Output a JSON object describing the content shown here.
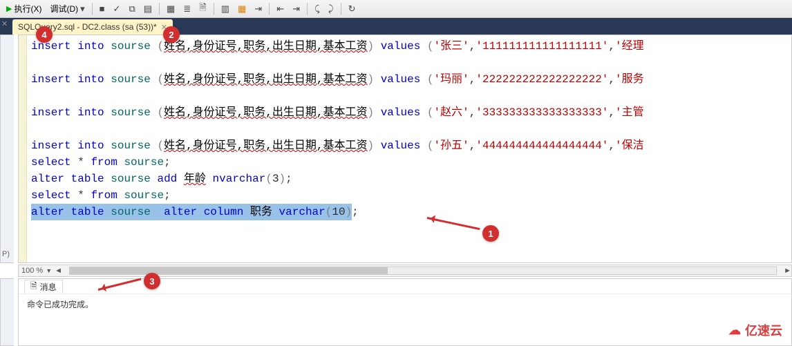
{
  "toolbar": {
    "execute_label": "执行(X)",
    "debug_label": "调试(D)"
  },
  "tab": {
    "title": "SQLQuery2.sql - DC2.class (sa (53))*"
  },
  "code": {
    "l1": {
      "kw1": "insert",
      "kw2": "into",
      "ident": "sourse",
      "paren_open": "(",
      "cols": "姓名,身份证号,职务,出生日期,基本工资",
      "paren_close": ")",
      "kw3": "values",
      "v_open": "(",
      "s1": "'张三'",
      "c": ",",
      "s2": "'111111111111111111'",
      "s3": "'经理"
    },
    "l3": {
      "kw1": "insert",
      "kw2": "into",
      "ident": "sourse",
      "paren_open": "(",
      "cols": "姓名,身份证号,职务,出生日期,基本工资",
      "paren_close": ")",
      "kw3": "values",
      "v_open": "(",
      "s1": "'玛丽'",
      "c": ",",
      "s2": "'222222222222222222'",
      "s3": "'服务"
    },
    "l5": {
      "kw1": "insert",
      "kw2": "into",
      "ident": "sourse",
      "paren_open": "(",
      "cols": "姓名,身份证号,职务,出生日期,基本工资",
      "paren_close": ")",
      "kw3": "values",
      "v_open": "(",
      "s1": "'赵六'",
      "c": ",",
      "s2": "'333333333333333333'",
      "s3": "'主管"
    },
    "l7": {
      "kw1": "insert",
      "kw2": "into",
      "ident": "sourse",
      "paren_open": "(",
      "cols": "姓名,身份证号,职务,出生日期,基本工资",
      "paren_close": ")",
      "kw3": "values",
      "v_open": "(",
      "s1": "'孙五'",
      "c": ",",
      "s2": "'444444444444444444'",
      "s3": "'保洁"
    },
    "l8": {
      "kw1": "select",
      "star": "*",
      "kw2": "from",
      "ident": "sourse",
      "semi": ";"
    },
    "l9": {
      "kw1": "alter",
      "kw2": "table",
      "ident": "sourse",
      "kw3": "add",
      "col": "年龄",
      "typ": "nvarchar",
      "open": "(",
      "num": "3",
      "close": ")",
      "semi": ";"
    },
    "l10": {
      "kw1": "select",
      "star": "*",
      "kw2": "from",
      "ident": "sourse",
      "semi": ";"
    },
    "l11": {
      "kw1": "alter",
      "kw2": "table",
      "ident": "sourse",
      "kw3": "alter",
      "kw4": "column",
      "col": "职务",
      "typ": "varchar",
      "open": "(",
      "num": "10",
      "close": ")",
      "semi": ";"
    }
  },
  "zoom": {
    "value": "100 %"
  },
  "messages": {
    "tab_label": "消息",
    "line1": "命令已成功完成。"
  },
  "badges": {
    "b1": "1",
    "b2": "2",
    "b3": "3",
    "b4": "4"
  },
  "watermark": {
    "text": "亿速云"
  },
  "left_rail": {
    "label": "P)"
  }
}
